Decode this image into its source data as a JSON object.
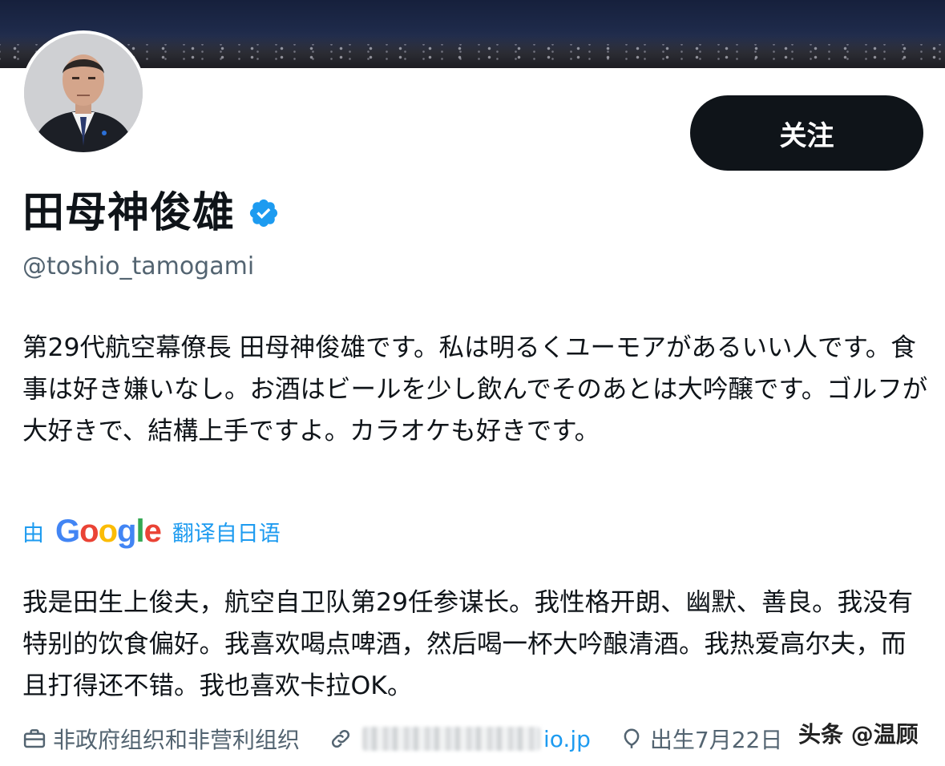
{
  "profile": {
    "follow_label": "关注",
    "name": "田母神俊雄",
    "handle": "@toshio_tamogami",
    "bio_original": "第29代航空幕僚長 田母神俊雄です。私は明るくユーモアがあるいい人です。食事は好き嫌いなし。お酒はビールを少し飲んでそのあとは大吟醸です。ゴルフが大好きで、結構上手ですよ。カラオケも好きです。",
    "translation": {
      "prefix": "由",
      "provider": "Google",
      "suffix": "翻译自日语"
    },
    "bio_translated": "我是田生上俊夫，航空自卫队第29任参谋长。我性格开朗、幽默、善良。我没有特别的饮食偏好。我喜欢喝点啤酒，然后喝一杯大吟酿清酒。我热爱高尔夫，而且打得还不错。我也喜欢卡拉OK。",
    "meta": {
      "category": "非政府组织和非营利组织",
      "website_visible": "io.jp",
      "birthday": "出生7月22日"
    }
  },
  "icons": [
    "briefcase-icon",
    "link-icon",
    "balloon-icon",
    "verified-badge-icon"
  ],
  "colors": {
    "accent": "#1d9bf0",
    "text": "#0f1419",
    "secondary": "#536471",
    "button_bg": "#0f1419"
  },
  "watermark": "头条 @温顾"
}
